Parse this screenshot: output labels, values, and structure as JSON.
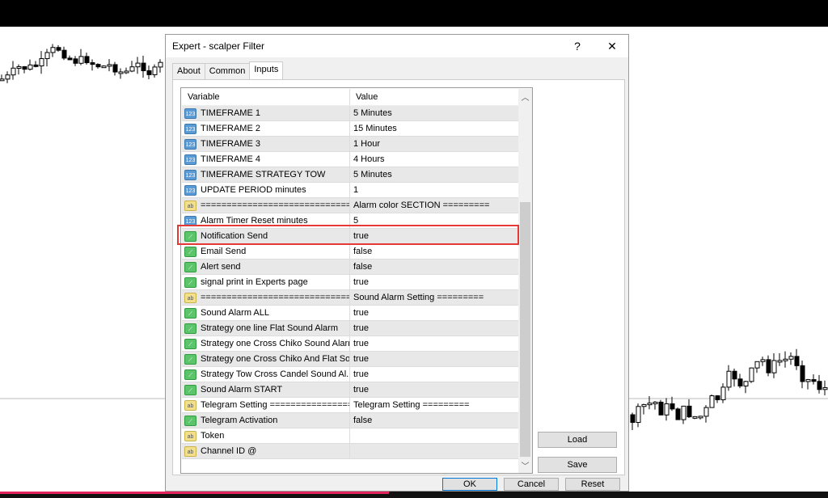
{
  "dialog": {
    "title": "Expert - scalper Filter",
    "help": "?",
    "close": "✕"
  },
  "tabs": [
    {
      "label": "About"
    },
    {
      "label": "Common"
    },
    {
      "label": "Inputs",
      "active": true
    }
  ],
  "grid": {
    "headers": {
      "variable": "Variable",
      "value": "Value"
    },
    "rows": [
      {
        "type": "num",
        "icon": "123",
        "name": "TIMEFRAME 1",
        "value": "5 Minutes"
      },
      {
        "type": "num",
        "icon": "123",
        "name": "TIMEFRAME 2",
        "value": "15 Minutes"
      },
      {
        "type": "num",
        "icon": "123",
        "name": "TIMEFRAME 3",
        "value": "1 Hour"
      },
      {
        "type": "num",
        "icon": "123",
        "name": "TIMEFRAME 4",
        "value": "4 Hours"
      },
      {
        "type": "num",
        "icon": "123",
        "name": "TIMEFRAME STRATEGY TOW",
        "value": "5 Minutes"
      },
      {
        "type": "num",
        "icon": "123",
        "name": "UPDATE PERIOD minutes",
        "value": "1"
      },
      {
        "type": "str",
        "icon": "ab",
        "name": "================================",
        "value": "Alarm color SECTION ========="
      },
      {
        "type": "num",
        "icon": "123",
        "name": "Alarm Timer Reset minutes",
        "value": "5"
      },
      {
        "type": "bool",
        "icon": "⟋",
        "name": "Notification Send",
        "value": "true",
        "highlighted": true
      },
      {
        "type": "bool",
        "icon": "⟋",
        "name": "Email Send",
        "value": "false"
      },
      {
        "type": "bool",
        "icon": "⟋",
        "name": "Alert send",
        "value": "false"
      },
      {
        "type": "bool",
        "icon": "⟋",
        "name": "signal print in Experts page",
        "value": "true"
      },
      {
        "type": "str",
        "icon": "ab",
        "name": "================================",
        "value": "Sound Alarm Setting ========="
      },
      {
        "type": "bool",
        "icon": "⟋",
        "name": "Sound Alarm ALL",
        "value": "true"
      },
      {
        "type": "bool",
        "icon": "⟋",
        "name": "Strategy one line Flat Sound Alarm",
        "value": "true"
      },
      {
        "type": "bool",
        "icon": "⟋",
        "name": "Strategy one Cross Chiko Sound Alarm",
        "value": "true"
      },
      {
        "type": "bool",
        "icon": "⟋",
        "name": "Strategy one Cross Chiko And Flat  So...",
        "value": "true"
      },
      {
        "type": "bool",
        "icon": "⟋",
        "name": "Strategy Tow Cross Candel  Sound Al...",
        "value": "true"
      },
      {
        "type": "bool",
        "icon": "⟋",
        "name": "Sound Alarm START",
        "value": "true"
      },
      {
        "type": "str",
        "icon": "ab",
        "name": "Telegram Setting =================",
        "value": "Telegram Setting ========="
      },
      {
        "type": "bool",
        "icon": "⟋",
        "name": "Telegram Activation",
        "value": "false"
      },
      {
        "type": "str",
        "icon": "ab",
        "name": "Token",
        "value": ""
      },
      {
        "type": "str",
        "icon": "ab",
        "name": "Channel ID @",
        "value": ""
      }
    ]
  },
  "buttons": {
    "load": "Load",
    "save": "Save",
    "ok": "OK",
    "cancel": "Cancel",
    "reset": "Reset"
  },
  "video": {
    "progress_percent": 47
  },
  "colors": {
    "highlight": "#e53935",
    "progress": "#e0245e"
  }
}
